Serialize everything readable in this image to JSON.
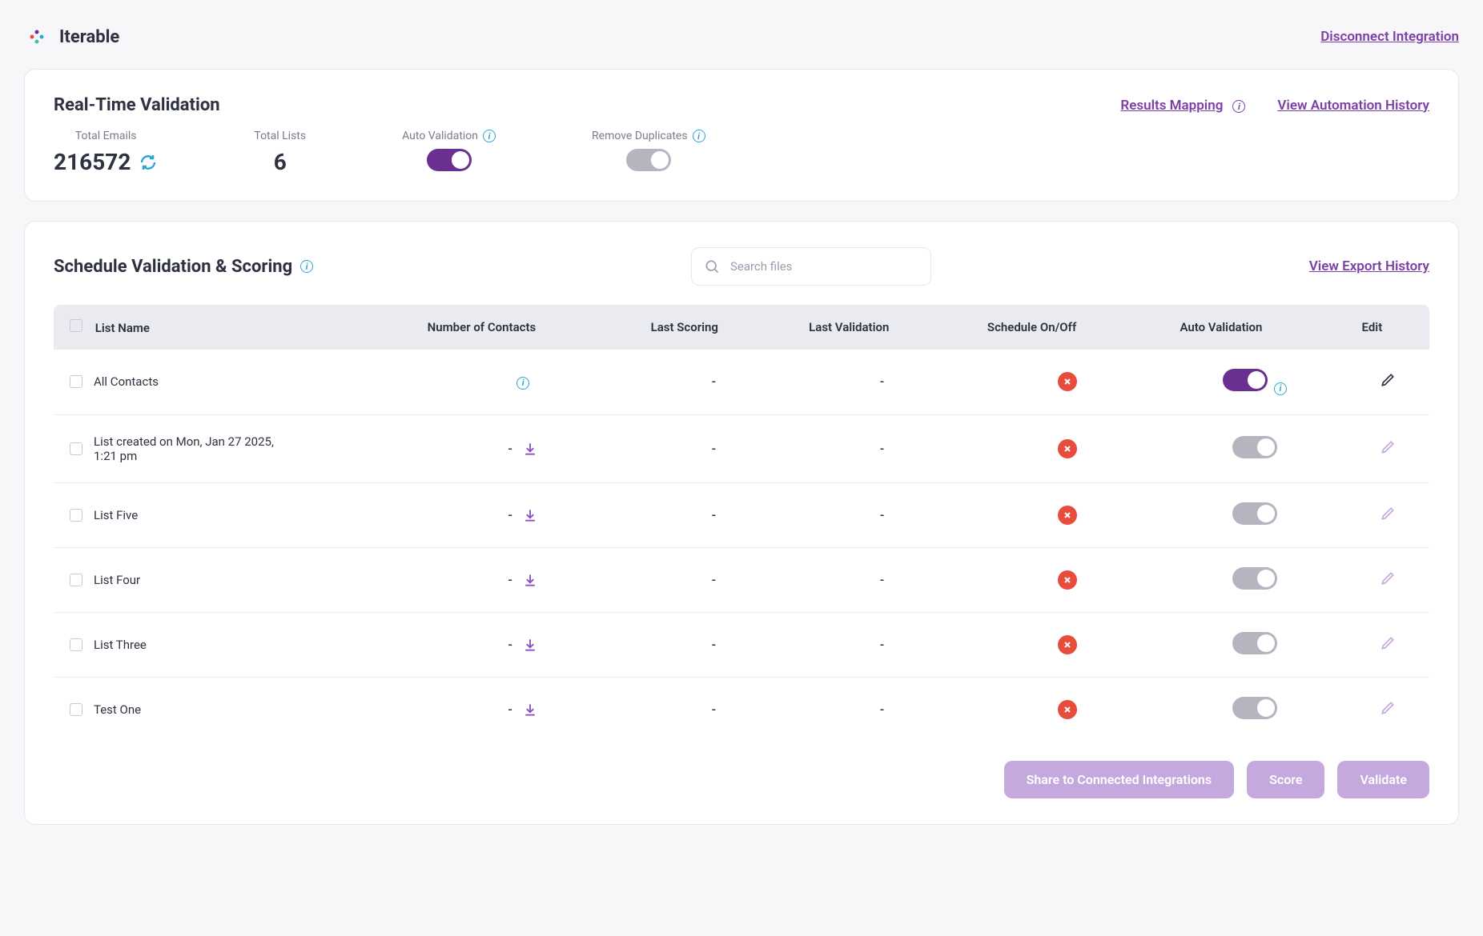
{
  "brand": "Iterable",
  "disconnect_label": "Disconnect Integration",
  "realtime": {
    "title": "Real-Time Validation",
    "links": {
      "results_mapping": "Results Mapping",
      "automation_history": "View Automation History"
    },
    "metrics": {
      "total_emails": {
        "label": "Total Emails",
        "value": "216572"
      },
      "total_lists": {
        "label": "Total Lists",
        "value": "6"
      },
      "auto_validation": {
        "label": "Auto Validation",
        "on": true
      },
      "remove_duplicates": {
        "label": "Remove Duplicates",
        "on": false
      }
    }
  },
  "schedule": {
    "title": "Schedule Validation & Scoring",
    "search_placeholder": "Search files",
    "export_history": "View Export History",
    "columns": {
      "list_name": "List Name",
      "contacts": "Number of Contacts",
      "last_scoring": "Last Scoring",
      "last_validation": "Last Validation",
      "schedule": "Schedule On/Off",
      "auto_validation": "Auto Validation",
      "edit": "Edit"
    },
    "rows": [
      {
        "name": "All Contacts",
        "contacts_info": true,
        "last_scoring": "-",
        "last_validation": "-",
        "schedule_on": false,
        "auto_on": true,
        "edit_active": true
      },
      {
        "name": "List created on Mon, Jan 27 2025, 1:21 pm",
        "contacts": "-",
        "download": true,
        "last_scoring": "-",
        "last_validation": "-",
        "schedule_on": false,
        "auto_on": false,
        "edit_active": false
      },
      {
        "name": "List Five",
        "contacts": "-",
        "download": true,
        "last_scoring": "-",
        "last_validation": "-",
        "schedule_on": false,
        "auto_on": false,
        "edit_active": false
      },
      {
        "name": "List Four",
        "contacts": "-",
        "download": true,
        "last_scoring": "-",
        "last_validation": "-",
        "schedule_on": false,
        "auto_on": false,
        "edit_active": false
      },
      {
        "name": "List Three",
        "contacts": "-",
        "download": true,
        "last_scoring": "-",
        "last_validation": "-",
        "schedule_on": false,
        "auto_on": false,
        "edit_active": false
      },
      {
        "name": "Test One",
        "contacts": "-",
        "download": true,
        "last_scoring": "-",
        "last_validation": "-",
        "schedule_on": false,
        "auto_on": false,
        "edit_active": false
      }
    ],
    "actions": {
      "share": "Share to Connected Integrations",
      "score": "Score",
      "validate": "Validate"
    }
  }
}
